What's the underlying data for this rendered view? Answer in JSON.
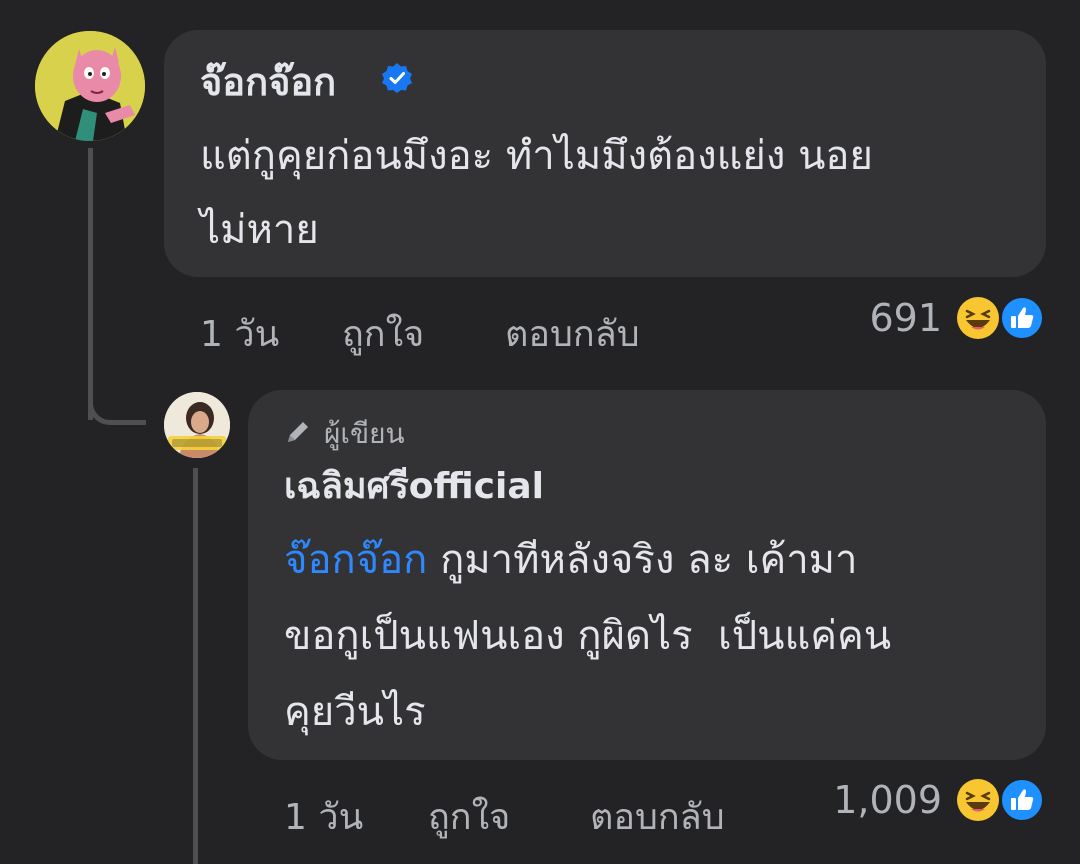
{
  "comment": {
    "author": "จ๊อกจ๊อก",
    "verified": true,
    "text_line1": "แต่กูคุยก่อนมึงอะ ทำไมมึงต้องแย่ง นอย",
    "text_line2": "ไม่หาย",
    "time": "1 วัน",
    "like_label": "ถูกใจ",
    "reply_label": "ตอบกลับ",
    "reaction_count": "691",
    "reactions": [
      "haha-icon",
      "like-icon"
    ]
  },
  "reply": {
    "author_badge": "ผู้เขียน",
    "author": "เฉลิมศรีofficial",
    "mention": "จ๊อกจ๊อก",
    "text_line1": " กูมาทีหลังจริง ละ เค้ามา",
    "text_line2": "ขอกูเป็นแฟนเอง กูผิดไร  เป็นแค่คน",
    "text_line3": "คุยวีนไร",
    "time": "1 วัน",
    "like_label": "ถูกใจ",
    "reply_label": "ตอบกลับ",
    "reaction_count": "1,009",
    "reactions": [
      "haha-icon",
      "like-icon"
    ]
  },
  "colors": {
    "background": "#232325",
    "bubble": "#333335",
    "mention": "#2e89ff",
    "verified": "#1877f2"
  }
}
